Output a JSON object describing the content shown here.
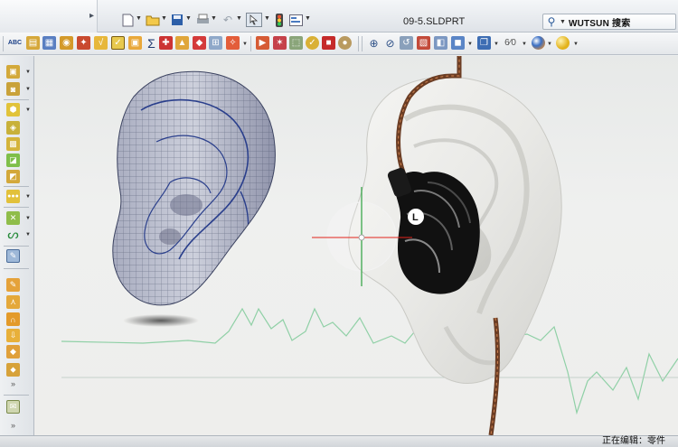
{
  "window": {
    "document_title": "09-5.SLDPRT"
  },
  "search": {
    "label": "WUTSUN 搜索"
  },
  "toolbar": {
    "spell_icon_text": "ABC"
  },
  "status": {
    "text": "正在编辑：零件"
  },
  "colors": {
    "selection_box": "#f7d43b",
    "axis_red": "#e2231a",
    "axis_green": "#1a9a2e",
    "wave": "#8fd0a6",
    "earphone": "#111111"
  },
  "icons": {
    "quick_access": [
      "menu-arrow-icon",
      "new-document-icon",
      "open-folder-icon",
      "save-icon",
      "print-icon",
      "undo-icon",
      "select-arrow-icon",
      "traffic-light-icon",
      "options-icon"
    ],
    "left_tools": [
      "extruded-boss-icon",
      "revolved-boss-icon",
      "swept-boss-icon",
      "lofted-boss-icon",
      "boundary-boss-icon",
      "extruded-cut-icon",
      "fillet-icon",
      "pattern-icon",
      "reference-geometry-icon",
      "curves-icon",
      "sketch-icon",
      "surface-extrude-icon",
      "surface-revolve-icon",
      "surface-sweep-icon",
      "surface-loft-icon",
      "surface-fill-icon",
      "surface-offset-icon",
      "surface-knit-icon",
      "expand-icon",
      "drawing-icon",
      "collapse-icon"
    ]
  }
}
